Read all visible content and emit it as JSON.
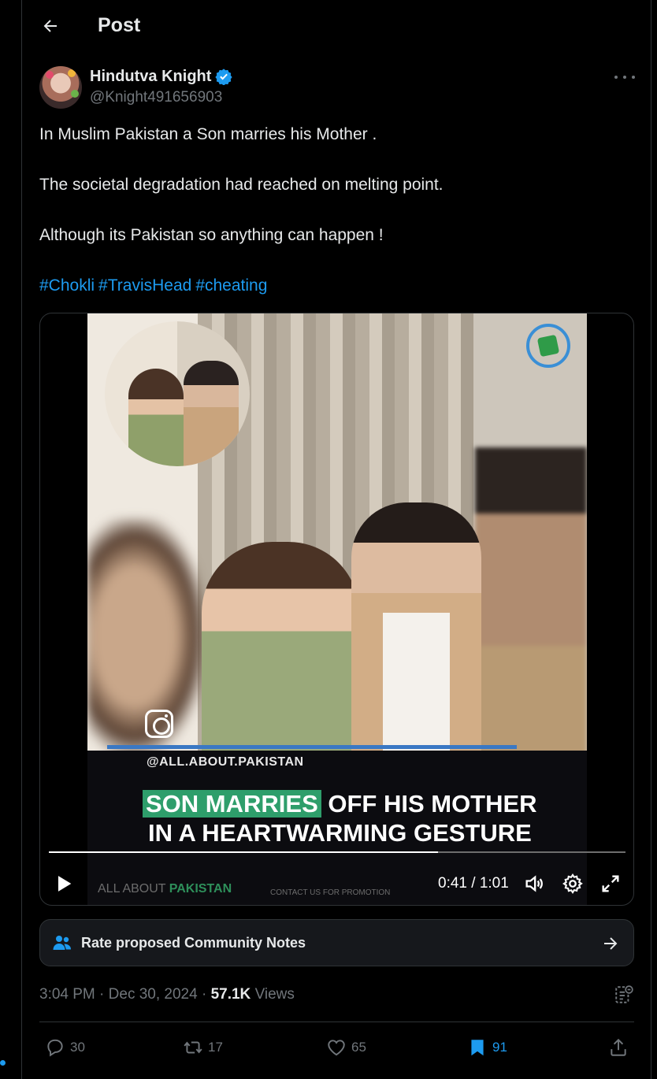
{
  "header": {
    "title": "Post"
  },
  "author": {
    "name": "Hindutva Knight",
    "handle": "@Knight491656903"
  },
  "post": {
    "lines": [
      "In Muslim Pakistan a Son marries his Mother .",
      "The societal degradation had reached on melting point.",
      "Although its Pakistan so anything can happen !"
    ],
    "hashtags": [
      "#Chokli",
      "#TravisHead",
      "#cheating"
    ]
  },
  "video": {
    "overlay_handle": "@ALL.ABOUT.PAKISTAN",
    "caption_highlight": "SON MARRIES",
    "caption_line1_rest": " OFF HIS MOTHER",
    "caption_line2": "IN A HEARTWARMING GESTURE",
    "brand_prefix": "ALL ABOUT ",
    "brand_suffix": "PAKISTAN",
    "promo_text": "CONTACT US FOR PROMOTION",
    "time": "0:41 / 1:01",
    "progress": 0.675
  },
  "community_notes": {
    "label": "Rate proposed Community Notes"
  },
  "meta": {
    "time": "3:04 PM",
    "date": "Dec 30, 2024",
    "views_count": "57.1K",
    "views_label": "Views"
  },
  "actions": {
    "replies": "30",
    "reposts": "17",
    "likes": "65",
    "bookmarks": "91"
  },
  "colors": {
    "accent": "#1d9bf0",
    "background": "#000000",
    "muted": "#71767b",
    "caption_highlight": "#2e9e6b"
  }
}
